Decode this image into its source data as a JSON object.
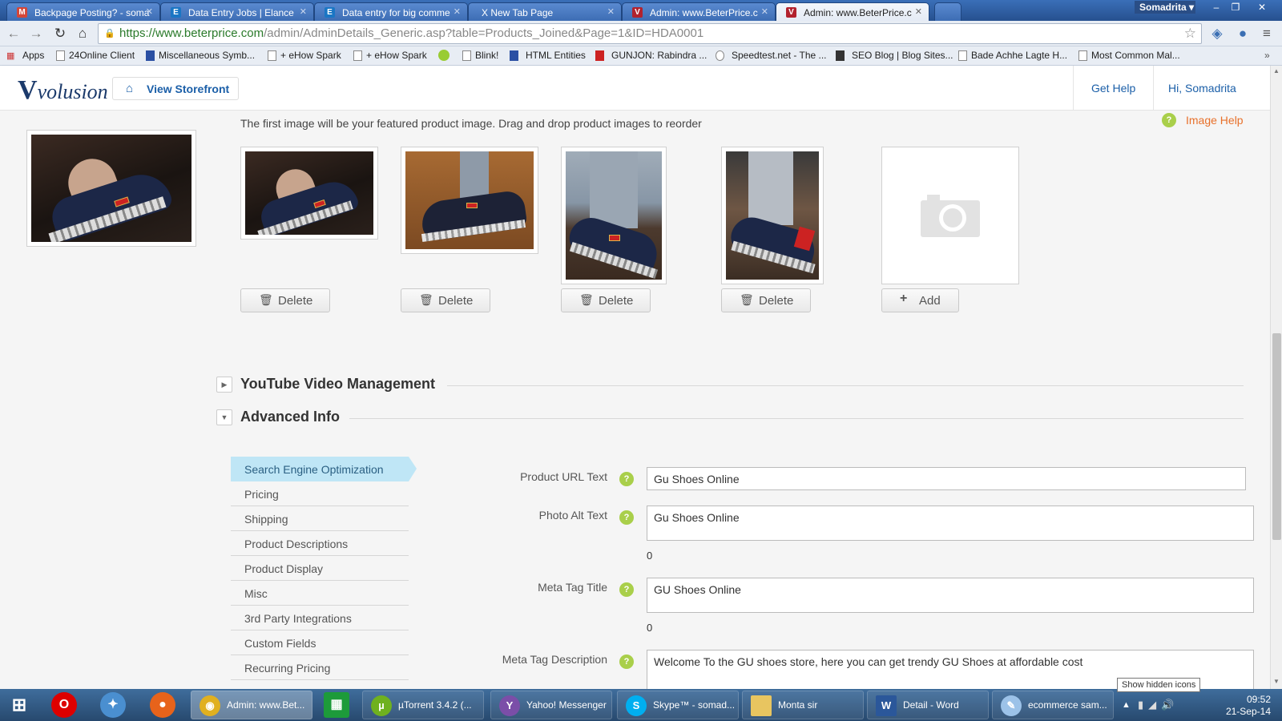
{
  "browser": {
    "tabs": [
      {
        "title": "Backpage Posting? - soma",
        "favicon": "gmail-icon",
        "color": "#d44638"
      },
      {
        "title": "Data Entry Jobs | Elance",
        "favicon": "elance-icon",
        "color": "#1a76c4"
      },
      {
        "title": "Data entry for big comme",
        "favicon": "elance-icon",
        "color": "#1a76c4"
      },
      {
        "title": "X New Tab Page",
        "favicon": "",
        "color": ""
      },
      {
        "title": "Admin: www.BeterPrice.c",
        "favicon": "volusion-icon",
        "color": "#b2222e"
      },
      {
        "title": "Admin: www.BeterPrice.c",
        "favicon": "volusion-icon",
        "color": "#b2222e"
      }
    ],
    "profile_name": "Somadrita",
    "url_host": "https://www.beterprice.com",
    "url_path": "/admin/AdminDetails_Generic.asp?table=Products_Joined&Page=1&ID=HDA0001",
    "bookmarks": [
      "Apps",
      "24Online Client",
      "Miscellaneous Symb...",
      "+ eHow Spark",
      "+ eHow Spark",
      "Blink!",
      "HTML Entities",
      "GUNJON: Rabindra ...",
      "Speedtest.net - The ...",
      "SEO Blog | Blog Sites...",
      "Bade Achhe Lagte H...",
      "Most Common Mal..."
    ]
  },
  "app": {
    "logo_text": "volusion",
    "view_storefront": "View Storefront",
    "get_help": "Get Help",
    "greeting": "Hi, Somadrita"
  },
  "images": {
    "hint": "The first image will be your featured product image. Drag and drop product images to reorder",
    "image_help": "Image Help",
    "delete_label": "Delete",
    "add_label": "Add"
  },
  "sections": {
    "youtube": "YouTube Video Management",
    "advanced": "Advanced Info"
  },
  "sidebar": {
    "items": [
      {
        "label": "Search Engine Optimization",
        "active": true
      },
      {
        "label": "Pricing"
      },
      {
        "label": "Shipping"
      },
      {
        "label": "Product Descriptions"
      },
      {
        "label": "Product Display"
      },
      {
        "label": "Misc"
      },
      {
        "label": "3rd Party Integrations"
      },
      {
        "label": "Custom Fields"
      },
      {
        "label": "Recurring Pricing"
      }
    ]
  },
  "form": {
    "url_label": "Product URL Text",
    "url_value": "Gu Shoes Online",
    "alt_label": "Photo Alt Text",
    "alt_value": "Gu Shoes Online",
    "alt_count": "0",
    "meta_title_label": "Meta Tag Title",
    "meta_title_value": "GU Shoes Online",
    "meta_title_count": "0",
    "meta_desc_label": "Meta Tag Description",
    "meta_desc_value": "Welcome To the GU shoes store, here you can get trendy GU Shoes at affordable cost"
  },
  "taskbar": {
    "items": [
      "Admin: www.Bet...",
      "µTorrent 3.4.2  (...",
      "Yahoo! Messenger",
      "Skype™ - somad...",
      "Monta sir",
      "Detail - Word",
      "ecommerce sam..."
    ],
    "tooltip": "Show hidden icons",
    "time": "09:52",
    "date": "21-Sep-14"
  },
  "colors": {
    "accent": "#1b5fa8",
    "help_orange": "#e8702a",
    "active_tab_bg": "#bfe6f6",
    "help_green": "#a9cf4a"
  }
}
